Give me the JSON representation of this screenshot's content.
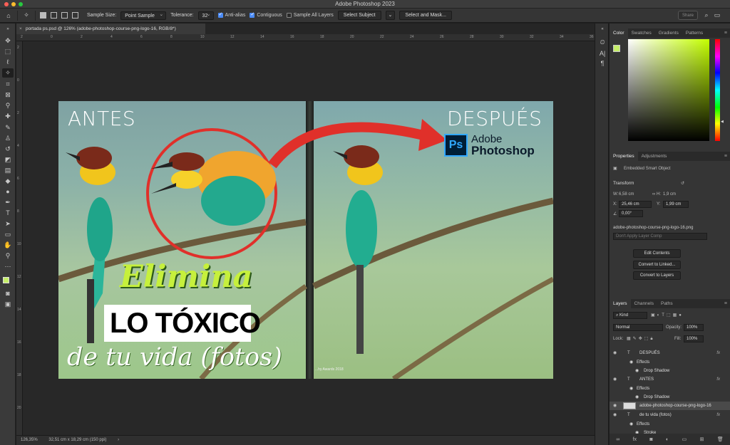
{
  "app": {
    "window_title": "Adobe Photoshop 2023",
    "share_label": "Share"
  },
  "colors": {
    "close": "#ff5f57",
    "minimize": "#febc2e",
    "maximize": "#28c840",
    "accent": "#4b8bf5",
    "foreground_color": "#c6ef6a",
    "background_color": "#9ad85c"
  },
  "options_bar": {
    "sample_size_label": "Sample Size:",
    "sample_size_value": "Point Sample",
    "tolerance_label": "Tolerance:",
    "tolerance_value": "32",
    "anti_alias_label": "Anti-alias",
    "anti_alias_checked": true,
    "contiguous_label": "Contiguous",
    "contiguous_checked": true,
    "sample_all_layers_label": "Sample All Layers",
    "sample_all_layers_checked": false,
    "select_subject_label": "Select Subject",
    "select_and_mask_label": "Select and Mask..."
  },
  "document": {
    "tab_title": "portada ps.psd @ 126% (adobe-photoshop-course-png-logo-16, RGB/8*)",
    "zoom": "126,35%",
    "dimensions": "32,51 cm x 18,29 cm (150 ppi)",
    "ruler_numbers": [
      "2",
      "0",
      "2",
      "4",
      "6",
      "8",
      "10",
      "12",
      "14",
      "16",
      "18",
      "20",
      "22",
      "24",
      "26",
      "28",
      "30",
      "32",
      "34",
      "36"
    ],
    "left_ruler_numbers": [
      "2",
      "0",
      "2",
      "4",
      "6",
      "8",
      "10",
      "12",
      "14",
      "16",
      "18",
      "20"
    ]
  },
  "image": {
    "label_before": "ANTES",
    "label_after": "DESPUÉS",
    "ps_icon_text": "Ps",
    "ps_word1": "Adobe",
    "ps_word2": "Photoshop",
    "headline1": "Elimina",
    "headline2": "LO TÓXICO",
    "headline3": "de tu vida (fotos)",
    "credit": "...hy Awards 2018"
  },
  "color_panel": {
    "tabs": [
      "Color",
      "Swatches",
      "Gradients",
      "Patterns"
    ]
  },
  "properties_panel": {
    "tabs": [
      "Properties",
      "Adjustments"
    ],
    "type": "Embedded Smart Object",
    "transform_label": "Transform",
    "w_label": "W:",
    "w_value": "6,58 cm",
    "h_label": "H:",
    "h_value": "1,9 cm",
    "x_label": "X:",
    "x_value": "25,46 cm",
    "y_label": "Y:",
    "y_value": "1,99 cm",
    "angle_value": "0,00°",
    "filename": "adobe-photoshop-course-png-logo-16.png",
    "layer_comp_placeholder": "Don't Apply Layer Comp",
    "edit_contents": "Edit Contents",
    "convert_linked": "Convert to Linked...",
    "convert_layers": "Convert to Layers"
  },
  "layers_panel": {
    "tabs": [
      "Layers",
      "Channels",
      "Paths"
    ],
    "filter_kind": "Kind",
    "blend_mode": "Normal",
    "opacity_label": "Opacity:",
    "opacity_value": "100%",
    "lock_label": "Lock:",
    "fill_label": "Fill:",
    "fill_value": "100%",
    "layers": [
      {
        "name": "DESPUÉS",
        "type": "text",
        "fx": true
      },
      {
        "name": "Effects",
        "type": "effects"
      },
      {
        "name": "Drop Shadow",
        "type": "effect"
      },
      {
        "name": "ANTES",
        "type": "text",
        "fx": true
      },
      {
        "name": "Effects",
        "type": "effects"
      },
      {
        "name": "Drop Shadow",
        "type": "effect"
      },
      {
        "name": "adobe-photoshop-course-png-logo-16",
        "type": "smart",
        "selected": true
      },
      {
        "name": "de tu vida (fotos)",
        "type": "text",
        "fx": true
      },
      {
        "name": "Effects",
        "type": "effects"
      },
      {
        "name": "Stroke",
        "type": "effect"
      }
    ]
  }
}
